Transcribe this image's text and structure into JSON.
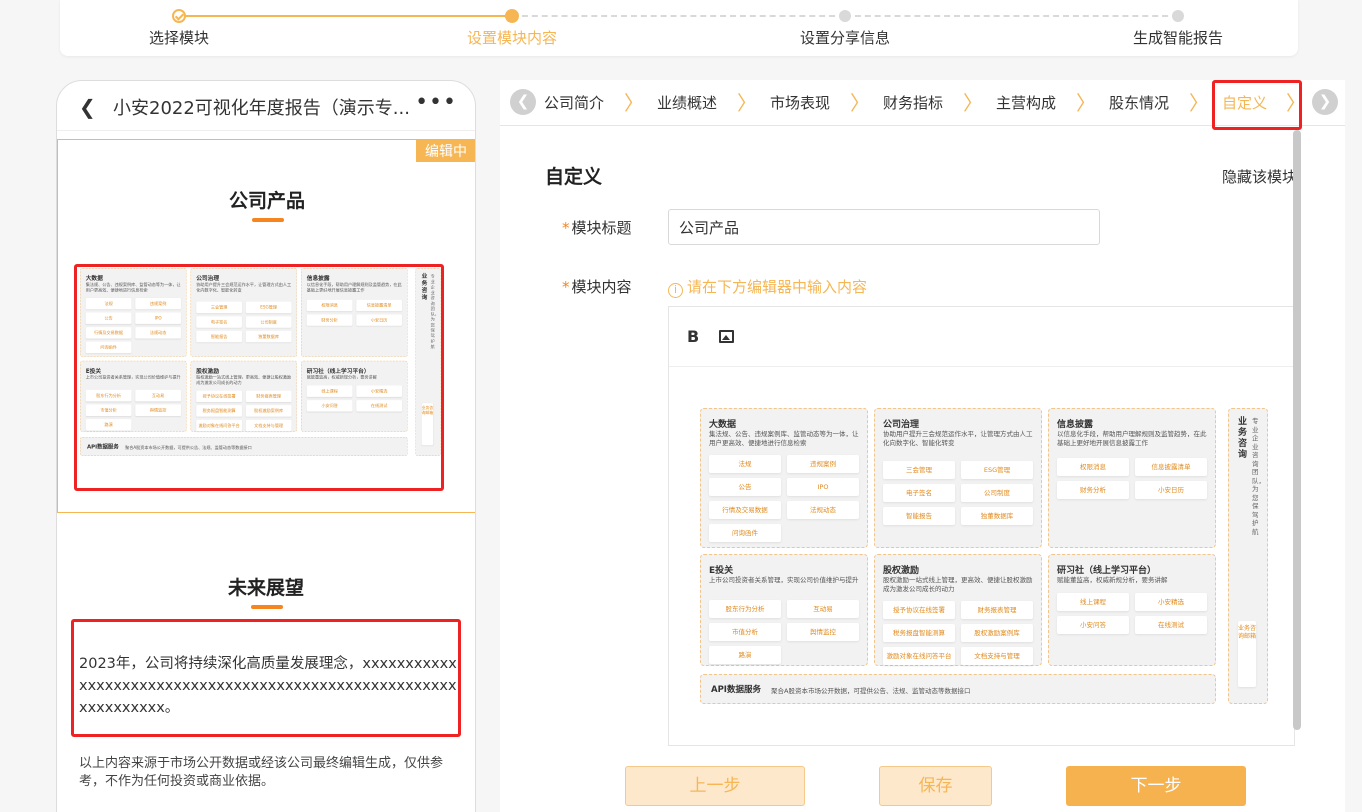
{
  "stepper": {
    "steps": [
      {
        "label": "选择模块",
        "state": "done"
      },
      {
        "label": "设置模块内容",
        "state": "active"
      },
      {
        "label": "设置分享信息",
        "state": "todo"
      },
      {
        "label": "生成智能报告",
        "state": "todo"
      }
    ]
  },
  "phone": {
    "title": "小安2022可视化年度报告（演示专...",
    "editing_badge": "编辑中",
    "module_title": "公司产品",
    "future_title": "未来展望",
    "future_text": "2023年，公司将持续深化高质量发展理念，xxxxxxxxxxxxxxxxxxxxxxxxxxxxxxxxxxxxxxxxxxxxxxxxxxxxxxxxxxxxxxxxx。",
    "disclaimer": "以上内容来源于市场公开数据或经该公司最终编辑生成，仅供参考，不作为任何投资或商业依据。"
  },
  "tabs": {
    "items": [
      "公司简介",
      "业绩概述",
      "市场表现",
      "财务指标",
      "主营构成",
      "股东情况",
      "自定义"
    ],
    "active_index": 6
  },
  "form": {
    "section_title": "自定义",
    "hide_link": "隐藏该模块",
    "title_label": "模块标题",
    "title_value": "公司产品",
    "content_label": "模块内容",
    "content_hint": "请在下方编辑器中输入内容",
    "required_mark": "*"
  },
  "diagram": {
    "cards": [
      {
        "title": "大数据",
        "desc": "集法规、公告、违规案例库、监管动态等为一体，让用户更高效、便捷地进行信息检索",
        "chips": [
          "法规",
          "违规案例",
          "公告",
          "IPO",
          "行情及交易数据",
          "法规动态",
          "问询函件"
        ]
      },
      {
        "title": "公司治理",
        "desc": "协助用户提升三会规范运作水平，让管理方式由人工化向数字化、智能化转变",
        "chips": [
          "三会管理",
          "ESG管理",
          "电子签名",
          "公司制度",
          "智能报告",
          "独董数据库"
        ]
      },
      {
        "title": "信息披露",
        "desc": "以信息化手段，帮助用户理解规则及监管趋势，在此基础上更好地开展信息披露工作",
        "chips": [
          "权限消息",
          "信息披露清单",
          "财务分析",
          "小安日历"
        ]
      },
      {
        "title": "E投关",
        "desc": "上市公司投资者关系管理，实现公司价值维护与提升",
        "chips": [
          "股东行为分析",
          "互动易",
          "市值分析",
          "舆情监控",
          "路演"
        ]
      },
      {
        "title": "股权激励",
        "desc": "股权激励一站式线上管理，更高效、便捷让股权激励成为激发公司成长的动力",
        "chips": [
          "授予协议在线签署",
          "财务报表管理",
          "税务报盘智能测算",
          "股权激励案例库",
          "激励对象在线问答平台",
          "文档支持与管理"
        ]
      },
      {
        "title": "研习社（线上学习平台）",
        "desc": "赋能董监高，权威新规分析，要务讲解",
        "chips": [
          "线上课程",
          "小安精选",
          "小安问答",
          "在线测试"
        ]
      }
    ],
    "side": {
      "title": "业务咨询",
      "desc": "专业企业咨询团队，为您保驾护航",
      "chip": "业务咨询邮箱"
    },
    "api": {
      "title": "API数据服务",
      "desc": "聚合A股资本市场公开数据，可提供公告、法规、监管动态等数据接口"
    }
  },
  "buttons": {
    "prev": "上一步",
    "save": "保存",
    "next": "下一步"
  },
  "colors": {
    "accent": "#f6b654",
    "highlight_red": "#e22222"
  }
}
